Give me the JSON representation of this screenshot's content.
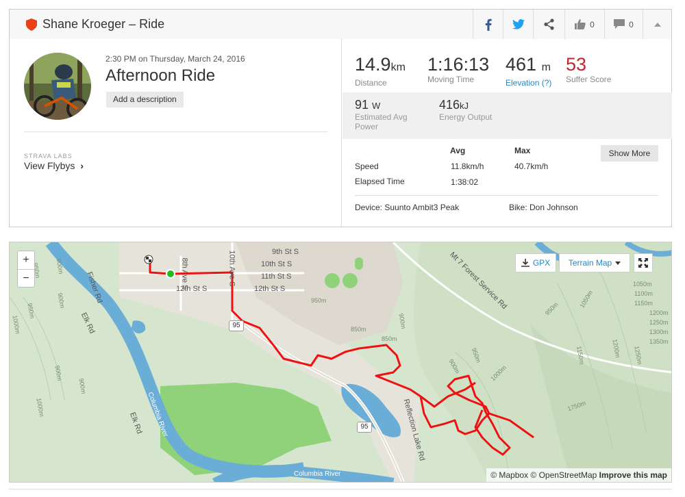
{
  "header": {
    "title": "Shane Kroeger – Ride",
    "kudos_count": "0",
    "comments_count": "0"
  },
  "activity": {
    "datetime": "2:30 PM on Thursday, March 24, 2016",
    "title": "Afternoon Ride",
    "add_description": "Add a description",
    "labs_label": "STRAVA LABS",
    "flybys_label": "View Flybys"
  },
  "stats": {
    "distance": {
      "value": "14.9",
      "unit": "km",
      "label": "Distance"
    },
    "moving_time": {
      "value": "1:16:13",
      "label": "Moving Time"
    },
    "elevation": {
      "value": "461",
      "unit": "m",
      "label": "Elevation (?)"
    },
    "suffer": {
      "value": "53",
      "label": "Suffer Score"
    },
    "power": {
      "value": "91",
      "unit": "W",
      "label": "Estimated Avg Power"
    },
    "energy": {
      "value": "416",
      "unit": "kJ",
      "label": "Energy Output"
    }
  },
  "table": {
    "avg_header": "Avg",
    "max_header": "Max",
    "speed_label": "Speed",
    "speed_avg": "11.8km/h",
    "speed_max": "40.7km/h",
    "elapsed_label": "Elapsed Time",
    "elapsed_avg": "1:38:02",
    "show_more": "Show More",
    "device": "Device: Suunto Ambit3 Peak",
    "bike": "Bike: Don Johnson"
  },
  "map": {
    "zoom_in": "+",
    "zoom_out": "−",
    "gpx": "GPX",
    "terrain": "Terrain Map",
    "attribution_mapbox": "© Mapbox",
    "attribution_osm": "© OpenStreetMap",
    "attribution_improve": "Improve this map",
    "streets": [
      "9th St S",
      "10th St S",
      "11th St S",
      "12th St S",
      "12th St S"
    ],
    "avenues": [
      "8th Ave S",
      "10th Ave S"
    ],
    "roads": [
      "Fisher Rd",
      "Elk Rd",
      "Elk Rd",
      "Mt 7 Forest Service Rd",
      "Reflection Lake Rd"
    ],
    "rivers": [
      "Columbia River",
      "Columbia River"
    ],
    "highways": [
      "95",
      "95"
    ],
    "contours": [
      "1000m",
      "950m",
      "900m",
      "900m",
      "950m",
      "1000m",
      "900m",
      "900m",
      "950m",
      "850m",
      "850m",
      "900m",
      "950m",
      "1000m",
      "950m",
      "1050m",
      "1100m",
      "1150m",
      "1200m",
      "1250m",
      "1300m",
      "1350m",
      "1750m",
      "1200m",
      "1250m",
      "1150m",
      "1050m",
      "900m"
    ],
    "colors": {
      "route": "#ee1111",
      "water": "#6aaed8",
      "park": "#8fd27a",
      "land": "#d9e8d0",
      "urban": "#e8e4dc"
    }
  }
}
